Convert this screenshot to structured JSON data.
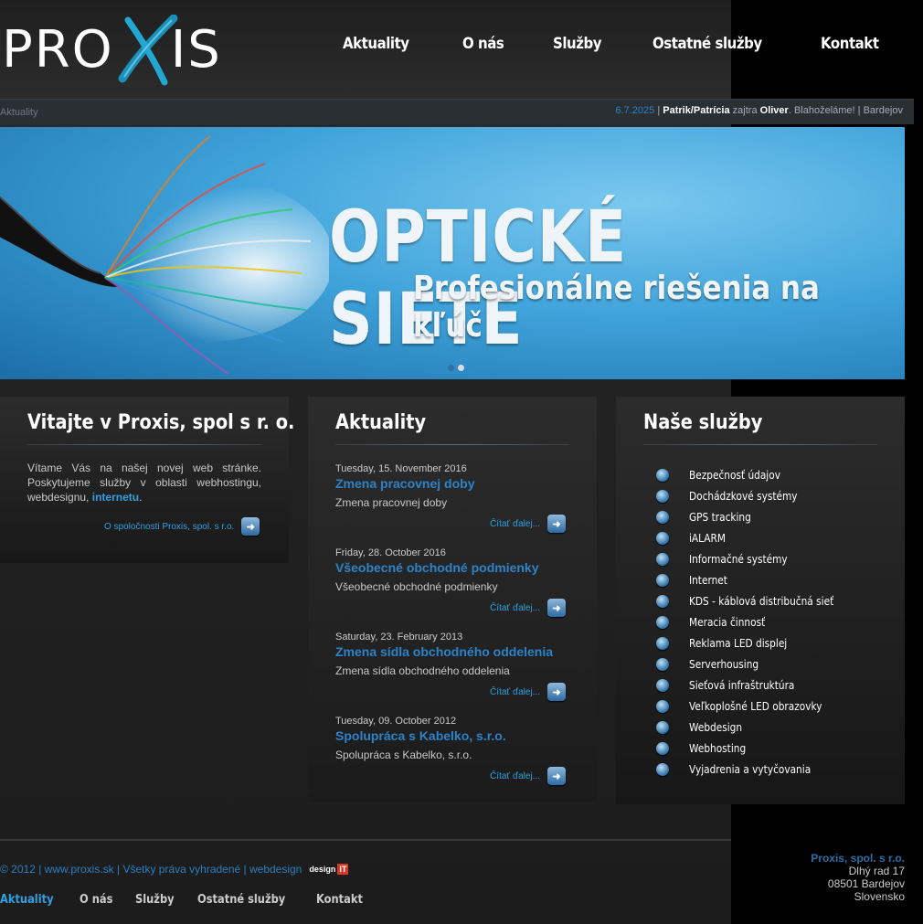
{
  "logo": {
    "text_left": "PRO",
    "text_right": "IS"
  },
  "nav": [
    "Aktuality",
    "O nás",
    "Služby",
    "Ostatné služby",
    "Kontakt"
  ],
  "infobar": {
    "breadcrumb": "Aktuality",
    "date": "6.7.2025",
    "sep1": "|",
    "today_names": "Patrik/Patrícia",
    "tomorrow_word": "zajtra",
    "tomorrow_name": "Oliver",
    "greeting": ". Blahoželáme!",
    "sep2": "|",
    "city": "Bardejov"
  },
  "banner": {
    "title": "OPTICKÉ SIETE",
    "subtitle": "Profesionálne riešenia na kľúč",
    "slides": 2,
    "active_slide": 1
  },
  "welcome": {
    "title": "Vitajte v Proxis, spol s r. o.",
    "text": "Vítame Vás na našej novej web stránke. Poskytujeme služby v oblasti webhostingu, webdesignu,",
    "link": "internetu",
    "after": ".",
    "more": "O spoločnosti Proxis, spol. s r.o."
  },
  "news": {
    "title": "Aktuality",
    "more_label": "Čítať ďalej...",
    "items": [
      {
        "date": "Tuesday, 15. November 2016",
        "title": "Zmena pracovnej doby",
        "text": "Zmena pracovnej doby"
      },
      {
        "date": "Friday, 28. October 2016",
        "title": "Všeobecné obchodné podmienky",
        "text": "Všeobecné obchodné podmienky"
      },
      {
        "date": "Saturday, 23. February 2013",
        "title": "Zmena sídla obchodného oddelenia",
        "text": "Zmena sídla obchodného oddelenia"
      },
      {
        "date": "Tuesday, 09. October 2012",
        "title": "Spolupráca s Kabelko, s.r.o.",
        "text": "Spolupráca s Kabelko, s.r.o."
      }
    ]
  },
  "services": {
    "title": "Naše služby",
    "items": [
      "Bezpečnosť údajov",
      "Dochádzkové systémy",
      "GPS tracking",
      "iALARM",
      "Informačné systémy",
      "Internet",
      "KDS - káblová distribučná sieť",
      "Meracia činnosť",
      "Reklama LED displej",
      "Serverhousing",
      "Sieťová infraštruktúra",
      "Veľkoplošné LED obrazovky",
      "Webdesign",
      "Webhosting",
      "Vyjadrenia a vytyčovania"
    ]
  },
  "footer": {
    "copyright": "© 2012 | www.proxis.sk | Všetky práva vyhradené | webdesign",
    "design_label": "design",
    "design_it": "IT",
    "nav": [
      "Aktuality",
      "O nás",
      "Služby",
      "Ostatné služby",
      "Kontakt"
    ],
    "address": {
      "company": "Proxis, spol. s r.o.",
      "street": "Dlhý rad 17",
      "city": "08501 Bardejov",
      "country": "Slovensko"
    }
  },
  "colors": {
    "accent": "#2fa0e0",
    "title_blue": "#2c83c8",
    "banner_blue": "#3fa3da"
  }
}
